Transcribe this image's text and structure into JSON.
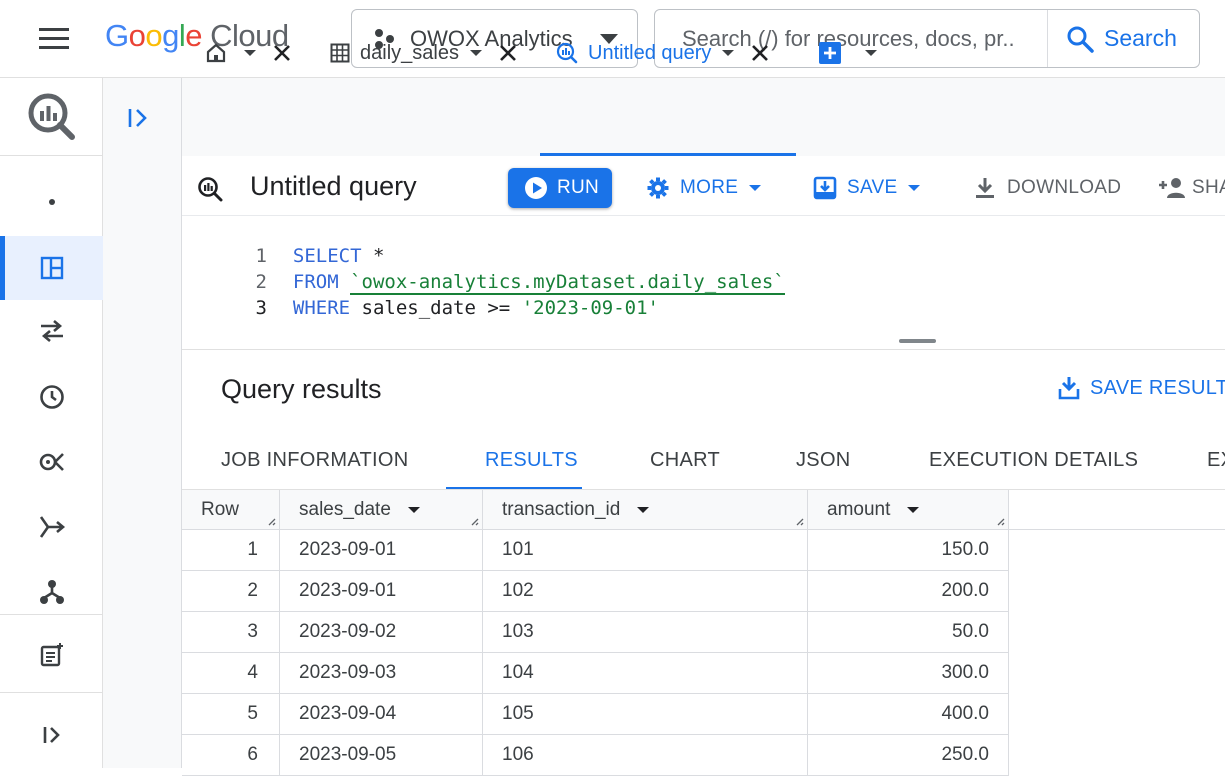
{
  "topbar": {
    "logo_google": "Google",
    "logo_cloud": "Cloud",
    "project_name": "OWOX Analytics",
    "search_placeholder": "Search (/) for resources, docs, pr..",
    "search_button": "Search"
  },
  "tabs": [
    {
      "label": "",
      "icon": "home-icon"
    },
    {
      "label": "daily_sales",
      "icon": "table-icon"
    },
    {
      "label": "Untitled query",
      "icon": "query-icon",
      "active": true
    }
  ],
  "toolbar": {
    "title": "Untitled query",
    "run": "RUN",
    "more": "MORE",
    "save": "SAVE",
    "download": "DOWNLOAD",
    "share": "SHA"
  },
  "editor": {
    "lines": [
      {
        "n": "1",
        "kw": "SELECT",
        "rest": " *"
      },
      {
        "n": "2",
        "kw": "FROM",
        "table": "`owox-analytics.myDataset.daily_sales`"
      },
      {
        "n": "3",
        "kw": "WHERE",
        "rest": " sales_date >= ",
        "str": "'2023-09-01'"
      }
    ]
  },
  "results": {
    "title": "Query results",
    "save_results": "SAVE RESULTS",
    "tabs": [
      "JOB INFORMATION",
      "RESULTS",
      "CHART",
      "JSON",
      "EXECUTION DETAILS",
      "EX"
    ],
    "active_tab": "RESULTS",
    "columns": [
      "Row",
      "sales_date",
      "transaction_id",
      "amount"
    ],
    "rows": [
      [
        "1",
        "2023-09-01",
        "101",
        "150.0"
      ],
      [
        "2",
        "2023-09-01",
        "102",
        "200.0"
      ],
      [
        "3",
        "2023-09-02",
        "103",
        "50.0"
      ],
      [
        "4",
        "2023-09-03",
        "104",
        "300.0"
      ],
      [
        "5",
        "2023-09-04",
        "105",
        "400.0"
      ],
      [
        "6",
        "2023-09-05",
        "106",
        "250.0"
      ]
    ]
  },
  "colors": {
    "accent": "#1a73e8",
    "string": "#188038",
    "keyword": "#3367d6"
  }
}
